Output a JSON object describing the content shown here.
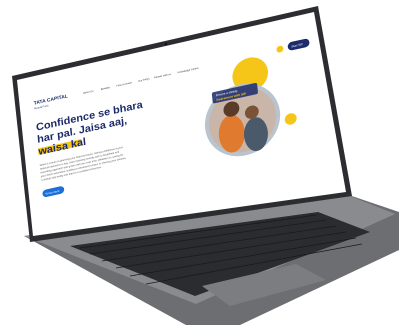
{
  "site": {
    "brand": "TATA CAPITAL",
    "brand_sub": "Mutual Fund",
    "nav_items": [
      "About Us",
      "Benefits",
      "How to invest",
      "Our FAQs",
      "Partner with us",
      "Knowledge Centre"
    ],
    "cta_label": "Start SIP",
    "headline_line1": "Confidence se bhara",
    "headline_line2": "har pal. Jaisa aaj,",
    "headline_line3": "waisa kal",
    "body_lines": [
      "When it comes to planning your financial future, having confidence in your",
      "financial decisions is key. Start investing smartly with a disciplined and",
      "rewarding approach that grows with you over time. Whether it's saving for",
      "your child's education, building a retirement corpus or chasing your dreams,",
      "a steady step today can lead to a confident tomorrow."
    ],
    "hero_button": "Know more",
    "photo_caption_line1": "Ensure a steady,",
    "photo_caption_line2": "Retirement with SIP"
  },
  "colors": {
    "navy": "#1b2a6b",
    "yellow": "#f5c518",
    "laptop_body": "#3a3b3f",
    "screen_bg": "#ffffff",
    "keys": "#1c1c1e"
  }
}
